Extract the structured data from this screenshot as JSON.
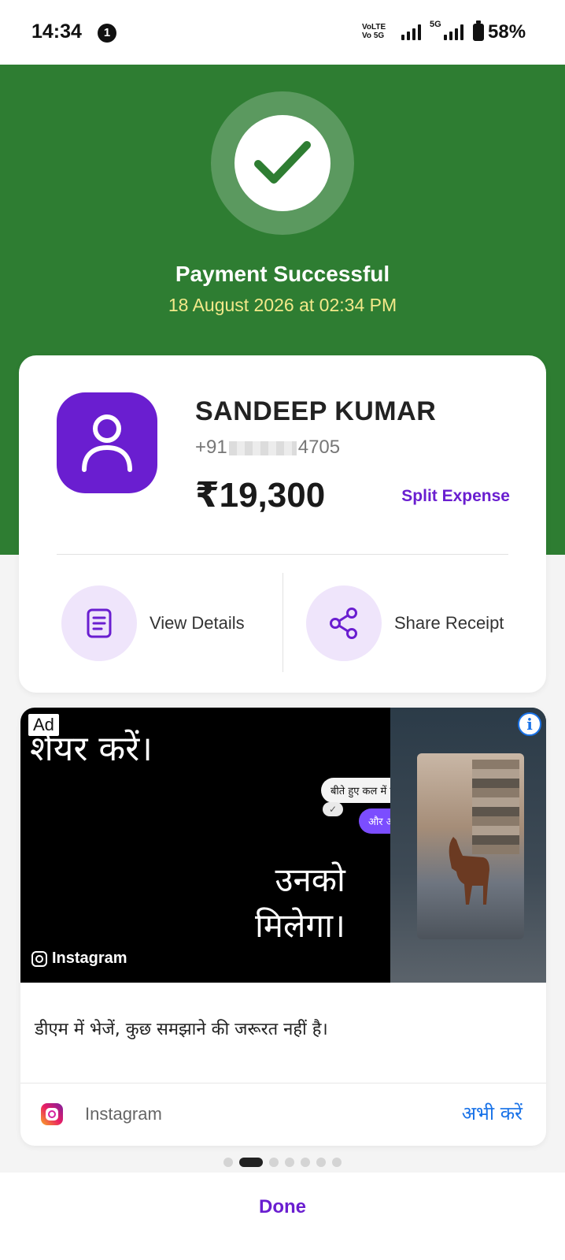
{
  "status_bar": {
    "time": "14:34",
    "notification_count": "1",
    "volte_line1": "VoLTE",
    "volte_line2": "Vo 5G",
    "net_5g": "5G",
    "battery": "58%"
  },
  "hero": {
    "title": "Payment Successful",
    "date": "18 August 2026 at 02:34 PM",
    "bg_color": "#2e7d32",
    "date_color": "#f3e98a"
  },
  "payment": {
    "payee_name": "SANDEEP KUMAR",
    "phone_prefix": "+91",
    "phone_suffix": "4705",
    "amount": "₹19,300",
    "split_label": "Split Expense",
    "accent_color": "#6a1ed0"
  },
  "actions": {
    "view_details": {
      "label": "View Details",
      "icon": "document-icon"
    },
    "share_receipt": {
      "label": "Share Receipt",
      "icon": "share-icon"
    }
  },
  "ad": {
    "tag": "Ad",
    "info": "i",
    "headline_top": "शेयर करें।",
    "headline_main_1": "उनको",
    "headline_main_2": "मिलेगा।",
    "chat_1": "बीते हुए कल में हम",
    "chat_tick": "✓",
    "chat_2": "और आज",
    "brand_badge": "Instagram",
    "body": "डीएम में भेजें, कुछ समझाने की जरूरत नहीं है।",
    "footer_name": "Instagram",
    "cta": "अभी करें"
  },
  "pager": {
    "count": 7,
    "active_index": 1
  },
  "footer": {
    "done_label": "Done"
  }
}
